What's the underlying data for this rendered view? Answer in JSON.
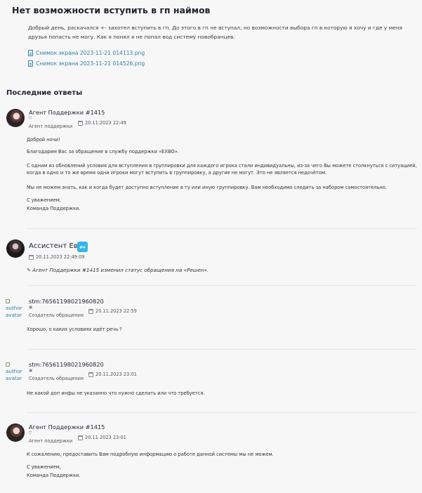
{
  "ticket": {
    "title": "Нет возможности вступить в гп наймов",
    "intro": "Добрый день, раскачался +- захотел вступить в гп. До этого в гп не вступал, но возможности выбора гп в которую я хочу и где у меня друзья попасть не могу. Как я понял я не попал вод систему новобранцев.",
    "files": [
      {
        "icon": "file-icon",
        "name": "Снимок экрана 2023-11-21 014113.png"
      },
      {
        "icon": "file-icon",
        "name": "Снимок экрана 2023-11-21 014526.png"
      }
    ]
  },
  "replies_section": {
    "title": "Последние ответы"
  },
  "replies": [
    {
      "author": "Агент Поддержки #1415",
      "role": "Агент поддержки",
      "date": "20.11.2023 22:49",
      "paragraphs": [
        "Доброй ночи!",
        "Благодарим Вас за обращение в службу поддержки «EXBO».",
        "С одним из обновлений условия для вступления в группировки для каждого игрока стали индивидуальны, из-за чего Вы можете столкнуться с ситуацией, когда в одно и то же время одни игроки могут вступить в группировку, а другие не могут. Это не является недочётом.",
        "Мы не можем знать, как и когда будет доступно вступление в ту или иную группировку. Вам необходимо следить за набором самостоятельно.",
        "С уважением,",
        "Команда Поддержки."
      ]
    },
    {
      "author": "Ассистент Ева",
      "badge": "gcp",
      "date": "20.11.2023 22:49:09",
      "status": "Агент Поддержки #1415 изменил статус обращения на «Решен»."
    },
    {
      "author": "stm:76561198021960820",
      "avatar_alt": "author avatar",
      "role": "Создатель обращения",
      "date": "20.11.2023 22:59",
      "paragraphs": [
        "Хорошо, о каких условиях идёт речь ?"
      ]
    },
    {
      "author": "stm:76561198021960820",
      "avatar_alt": "author avatar",
      "role": "Создатель обращения",
      "date": "20.11.2023 23:01",
      "paragraphs": [
        "Не какой доп инфы не указанно что нужно сделать или что требуется."
      ]
    },
    {
      "author": "Агент Поддержки #1415",
      "role": "Агент поддержки",
      "date": "20.11.2023 23:01",
      "paragraphs": [
        "К сожалению, предоставить Вам подробную информацию о работе данной системы мы не можем.",
        "С уважением,",
        "Команда Поддержки."
      ]
    }
  ]
}
